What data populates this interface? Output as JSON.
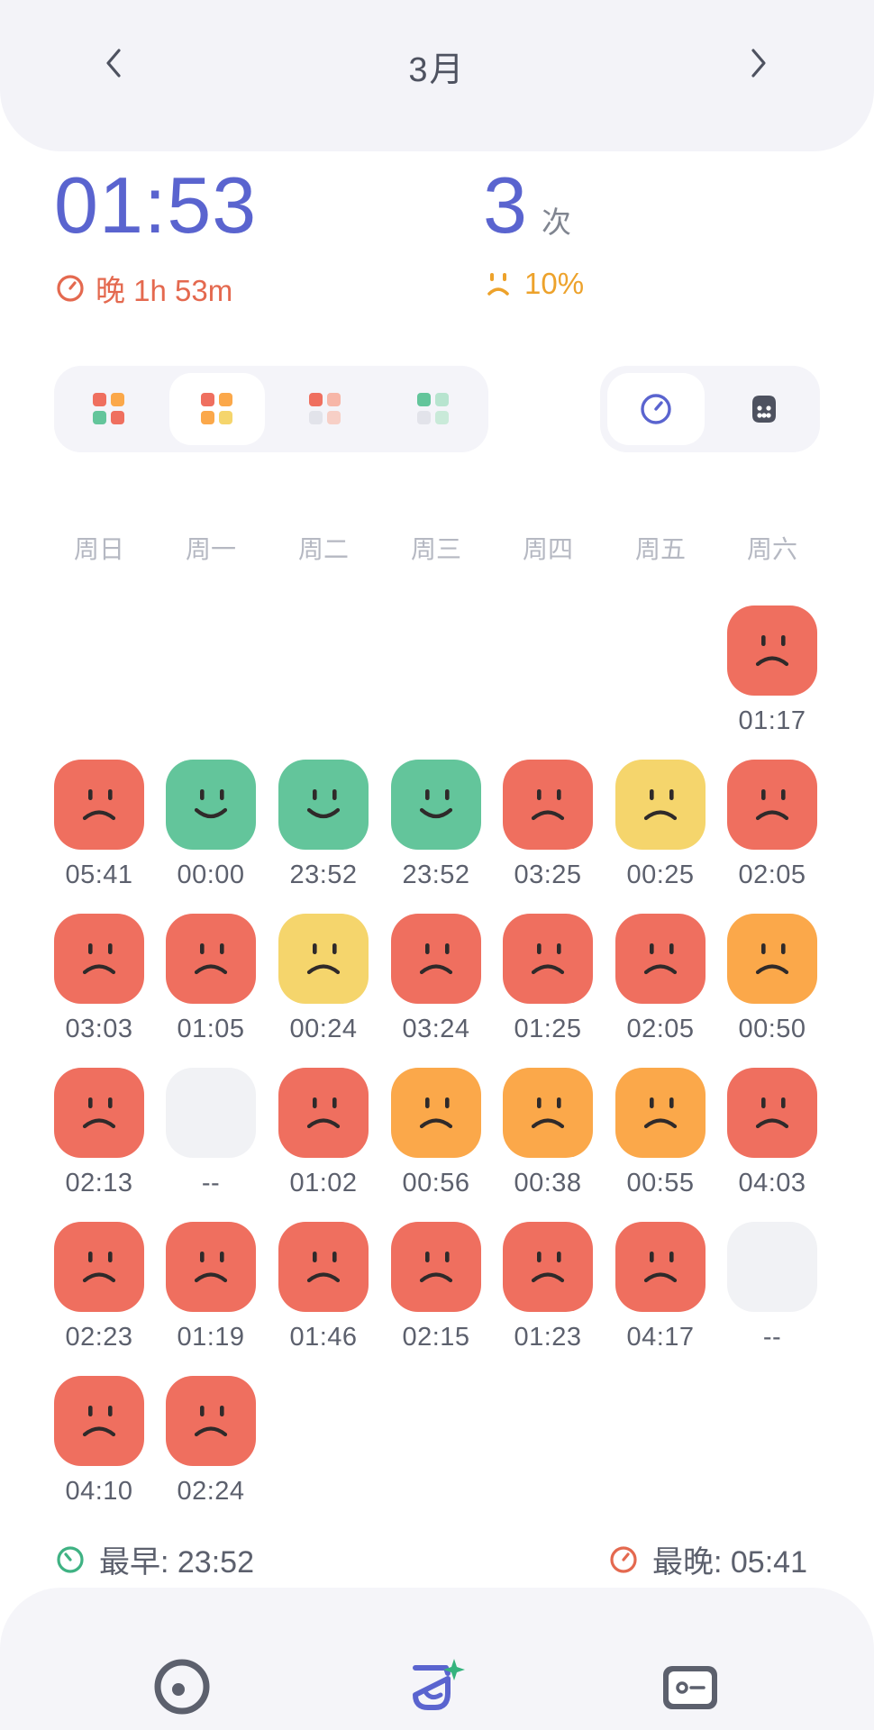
{
  "header": {
    "month": "3月"
  },
  "stats": {
    "avg_time": "01:53",
    "late_text": "晚 1h 53m",
    "count_value": "3",
    "count_unit": "次",
    "bad_percent": "10%"
  },
  "colors": {
    "primary": "#5a64cf",
    "late": "#e4694f",
    "red": "#ef6f5f",
    "orange": "#fba84a",
    "yellow": "#f5d56c",
    "green": "#63c59b",
    "empty": "#f1f2f5"
  },
  "theme_options": [
    {
      "name": "theme-classic",
      "active": false,
      "swatches": [
        "#ef6f5f",
        "#fba84a",
        "#63c59b",
        "#ef6f5f"
      ]
    },
    {
      "name": "theme-warm",
      "active": true,
      "swatches": [
        "#ef6f5f",
        "#fba84a",
        "#fba84a",
        "#f5d56c"
      ]
    },
    {
      "name": "theme-soft-red",
      "active": false,
      "swatches": [
        "#ef6f5f",
        "#f7b6a8",
        "#e2e3ea",
        "#f7cfc6"
      ]
    },
    {
      "name": "theme-soft-green",
      "active": false,
      "swatches": [
        "#63c59b",
        "#b7e4cf",
        "#e2e3ea",
        "#c9ead9"
      ]
    }
  ],
  "mode_options": [
    {
      "name": "mode-clock",
      "icon": "clock-icon",
      "active": true
    },
    {
      "name": "mode-dice",
      "icon": "dice-icon",
      "active": false
    }
  ],
  "weekdays": [
    "周日",
    "周一",
    "周二",
    "周三",
    "周四",
    "周五",
    "周六"
  ],
  "days": [
    {
      "row": 0,
      "col": 6,
      "mood": "sad",
      "color": "red",
      "time": "01:17"
    },
    {
      "row": 1,
      "col": 0,
      "mood": "sad",
      "color": "red",
      "time": "05:41"
    },
    {
      "row": 1,
      "col": 1,
      "mood": "happy",
      "color": "green",
      "time": "00:00"
    },
    {
      "row": 1,
      "col": 2,
      "mood": "happy",
      "color": "green",
      "time": "23:52"
    },
    {
      "row": 1,
      "col": 3,
      "mood": "happy",
      "color": "green",
      "time": "23:52"
    },
    {
      "row": 1,
      "col": 4,
      "mood": "sad",
      "color": "red",
      "time": "03:25"
    },
    {
      "row": 1,
      "col": 5,
      "mood": "sad",
      "color": "yellow",
      "time": "00:25"
    },
    {
      "row": 1,
      "col": 6,
      "mood": "sad",
      "color": "red",
      "time": "02:05"
    },
    {
      "row": 2,
      "col": 0,
      "mood": "sad",
      "color": "red",
      "time": "03:03"
    },
    {
      "row": 2,
      "col": 1,
      "mood": "sad",
      "color": "red",
      "time": "01:05"
    },
    {
      "row": 2,
      "col": 2,
      "mood": "sad",
      "color": "yellow",
      "time": "00:24"
    },
    {
      "row": 2,
      "col": 3,
      "mood": "sad",
      "color": "red",
      "time": "03:24"
    },
    {
      "row": 2,
      "col": 4,
      "mood": "sad",
      "color": "red",
      "time": "01:25"
    },
    {
      "row": 2,
      "col": 5,
      "mood": "sad",
      "color": "red",
      "time": "02:05"
    },
    {
      "row": 2,
      "col": 6,
      "mood": "sad",
      "color": "orange",
      "time": "00:50"
    },
    {
      "row": 3,
      "col": 0,
      "mood": "sad",
      "color": "red",
      "time": "02:13"
    },
    {
      "row": 3,
      "col": 1,
      "mood": "empty",
      "color": "empty",
      "time": "--"
    },
    {
      "row": 3,
      "col": 2,
      "mood": "sad",
      "color": "red",
      "time": "01:02"
    },
    {
      "row": 3,
      "col": 3,
      "mood": "sad",
      "color": "orange",
      "time": "00:56"
    },
    {
      "row": 3,
      "col": 4,
      "mood": "sad",
      "color": "orange",
      "time": "00:38"
    },
    {
      "row": 3,
      "col": 5,
      "mood": "sad",
      "color": "orange",
      "time": "00:55"
    },
    {
      "row": 3,
      "col": 6,
      "mood": "sad",
      "color": "red",
      "time": "04:03"
    },
    {
      "row": 4,
      "col": 0,
      "mood": "sad",
      "color": "red",
      "time": "02:23"
    },
    {
      "row": 4,
      "col": 1,
      "mood": "sad",
      "color": "red",
      "time": "01:19"
    },
    {
      "row": 4,
      "col": 2,
      "mood": "sad",
      "color": "red",
      "time": "01:46"
    },
    {
      "row": 4,
      "col": 3,
      "mood": "sad",
      "color": "red",
      "time": "02:15"
    },
    {
      "row": 4,
      "col": 4,
      "mood": "sad",
      "color": "red",
      "time": "01:23"
    },
    {
      "row": 4,
      "col": 5,
      "mood": "sad",
      "color": "red",
      "time": "04:17"
    },
    {
      "row": 4,
      "col": 6,
      "mood": "empty",
      "color": "empty",
      "time": "--"
    },
    {
      "row": 5,
      "col": 0,
      "mood": "sad",
      "color": "red",
      "time": "04:10"
    },
    {
      "row": 5,
      "col": 1,
      "mood": "sad",
      "color": "red",
      "time": "02:24"
    }
  ],
  "footer": {
    "earliest_label": "最早: 23:52",
    "latest_label": "最晚: 05:41"
  },
  "tabs": [
    {
      "name": "tab-home",
      "icon": "target-icon"
    },
    {
      "name": "tab-record",
      "icon": "sparkle-cup-icon"
    },
    {
      "name": "tab-profile",
      "icon": "id-card-icon"
    }
  ]
}
